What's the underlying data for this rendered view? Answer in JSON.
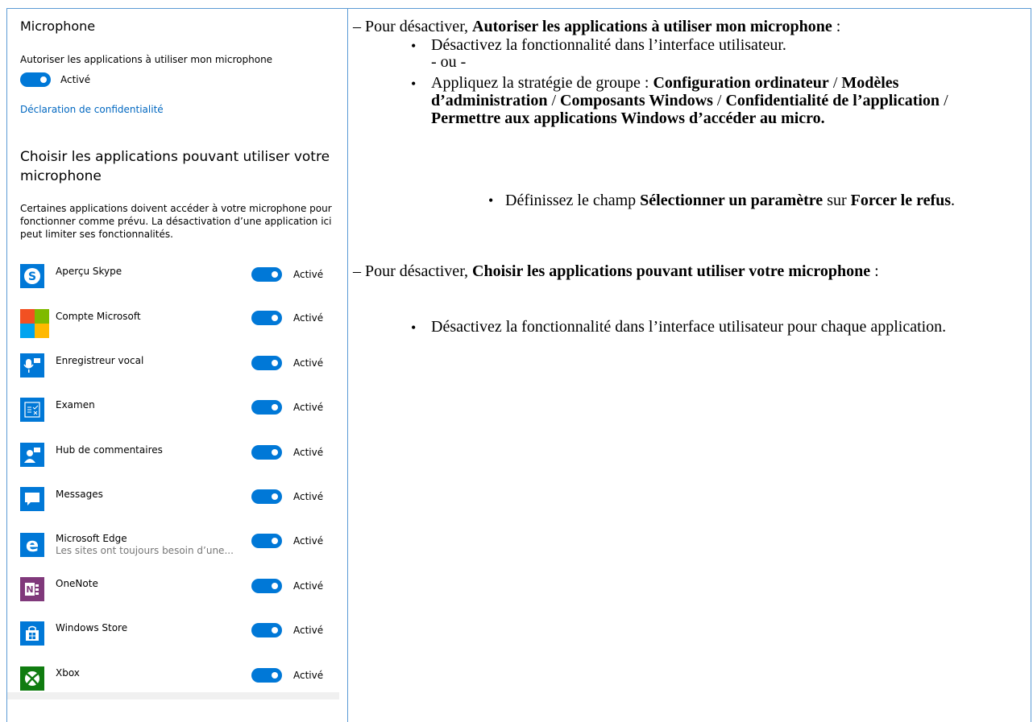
{
  "left": {
    "title": "Microphone",
    "allow_label": "Autoriser les applications à utiliser mon microphone",
    "allow_state": "Activé",
    "privacy_link": "Déclaration de confidentialité",
    "choose_title": "Choisir les applications pouvant utiliser votre microphone",
    "description": "Certaines applications doivent accéder à votre microphone pour fonctionner comme prévu. La désactivation d’une application ici peut limiter ses fonctionnalités.",
    "apps": [
      {
        "name": "Aperçu Skype",
        "sub": "",
        "state": "Activé",
        "icon": "skype-icon",
        "color": "#0078d7"
      },
      {
        "name": "Compte Microsoft",
        "sub": "",
        "state": "Activé",
        "icon": "microsoft-logo-icon",
        "color": "#f25022"
      },
      {
        "name": "Enregistreur vocal",
        "sub": "",
        "state": "Activé",
        "icon": "voice-recorder-icon",
        "color": "#0078d7"
      },
      {
        "name": "Examen",
        "sub": "",
        "state": "Activé",
        "icon": "exam-icon",
        "color": "#0078d7"
      },
      {
        "name": "Hub de commentaires",
        "sub": "",
        "state": "Activé",
        "icon": "feedback-hub-icon",
        "color": "#0078d7"
      },
      {
        "name": "Messages",
        "sub": "",
        "state": "Activé",
        "icon": "messages-icon",
        "color": "#0078d7"
      },
      {
        "name": "Microsoft Edge",
        "sub": "Les sites ont toujours besoin d’une...",
        "state": "Activé",
        "icon": "edge-icon",
        "color": "#0078d7"
      },
      {
        "name": "OneNote",
        "sub": "",
        "state": "Activé",
        "icon": "onenote-icon",
        "color": "#80397b"
      },
      {
        "name": "Windows Store",
        "sub": "",
        "state": "Activé",
        "icon": "store-icon",
        "color": "#0078d7"
      },
      {
        "name": "Xbox",
        "sub": "",
        "state": "Activé",
        "icon": "xbox-icon",
        "color": "#107c10"
      }
    ]
  },
  "right": {
    "p1_intro": "– Pour désactiver, ",
    "p1_bold": "Autoriser les applications à utiliser mon microphone",
    "p1_end": " :",
    "b1": "Désactivez la fonctionnalité dans l’interface utilisateur.",
    "or": "- ou -",
    "b2_intro": "Appliquez la stratégie de groupe : ",
    "b2_path1": "Configuration ordinateur",
    "sep": " / ",
    "b2_path2": "Modèles d’administration",
    "b2_path3": "Composants Windows",
    "b2_path4": "Confidentialité de l’application",
    "b2_path5": "Permettre aux applications Windows d’accéder au micro.",
    "sub_intro": "Définissez le champ ",
    "sub_field": "Sélectionner un paramètre",
    "sub_on": " sur ",
    "sub_value": "Forcer le refus",
    "sub_end": ".",
    "p2_intro": "– Pour désactiver, ",
    "p2_bold": "Choisir les applications pouvant utiliser votre microphone",
    "p2_end": " :",
    "b3": "Désactivez la fonctionnalité dans l’interface utilisateur pour chaque application."
  }
}
